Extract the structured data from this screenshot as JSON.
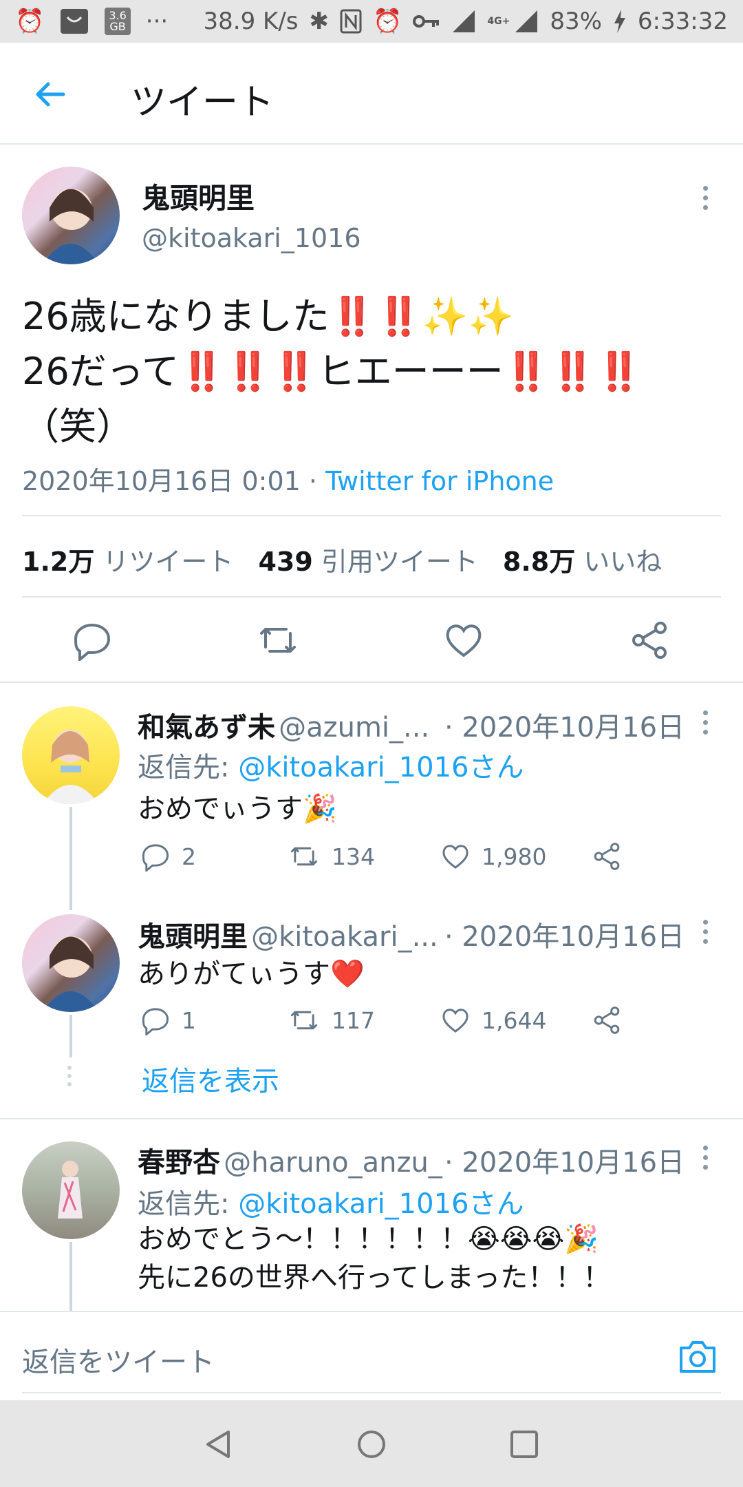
{
  "status_bar": {
    "data_size": "3.6",
    "data_unit": "GB",
    "more": "···",
    "speed": "38.9 K/s",
    "network": "4G+",
    "battery": "83%",
    "time": "6:33:32"
  },
  "header": {
    "title": "ツイート"
  },
  "main_tweet": {
    "name": "鬼頭明里",
    "handle": "@kitoakari_1016",
    "line1": "26歳になりました‼️‼️✨✨",
    "line2": "26だって‼️‼️‼️ヒエーーー‼️‼️‼️",
    "line3": "（笑）",
    "date": "2020年10月16日 0:01 · ",
    "source": "Twitter for iPhone",
    "stats": [
      {
        "count": "1.2万",
        "label": "リツイート"
      },
      {
        "count": "439",
        "label": "引用ツイート"
      },
      {
        "count": "8.8万",
        "label": "いいね"
      }
    ]
  },
  "replies": [
    {
      "name": "和氣あず未",
      "handle": "@azumi_...",
      "date": "· 2020年10月16日",
      "reply_to_prefix": "返信先: ",
      "reply_to": "@kitoakari_1016さん",
      "text": "おめでぃうす🎉",
      "reply_count": "2",
      "retweet_count": "134",
      "like_count": "1,980"
    },
    {
      "name": "鬼頭明里",
      "handle": "@kitoakari_...",
      "date": "· 2020年10月16日",
      "text": "ありがてぃうす❤️",
      "reply_count": "1",
      "retweet_count": "117",
      "like_count": "1,644",
      "show_replies": "返信を表示"
    },
    {
      "name": "春野杏",
      "handle": "@haruno_anzu_",
      "date": "· 2020年10月16日",
      "reply_to_prefix": "返信先: ",
      "reply_to": "@kitoakari_1016さん",
      "text_line1": "おめでとう〜！！！！！！😭😭😭🎉",
      "text_line2": "先に26の世界へ行ってしまった！！！"
    }
  ],
  "compose": {
    "placeholder": "返信をツイート"
  },
  "colors": {
    "accent": "#1da1f2",
    "muted": "#657786",
    "red_mark": "#e0245e"
  },
  "icons": [
    "back-arrow-icon",
    "reply-icon",
    "retweet-icon",
    "like-icon",
    "share-icon",
    "camera-icon",
    "kebab-icon"
  ]
}
